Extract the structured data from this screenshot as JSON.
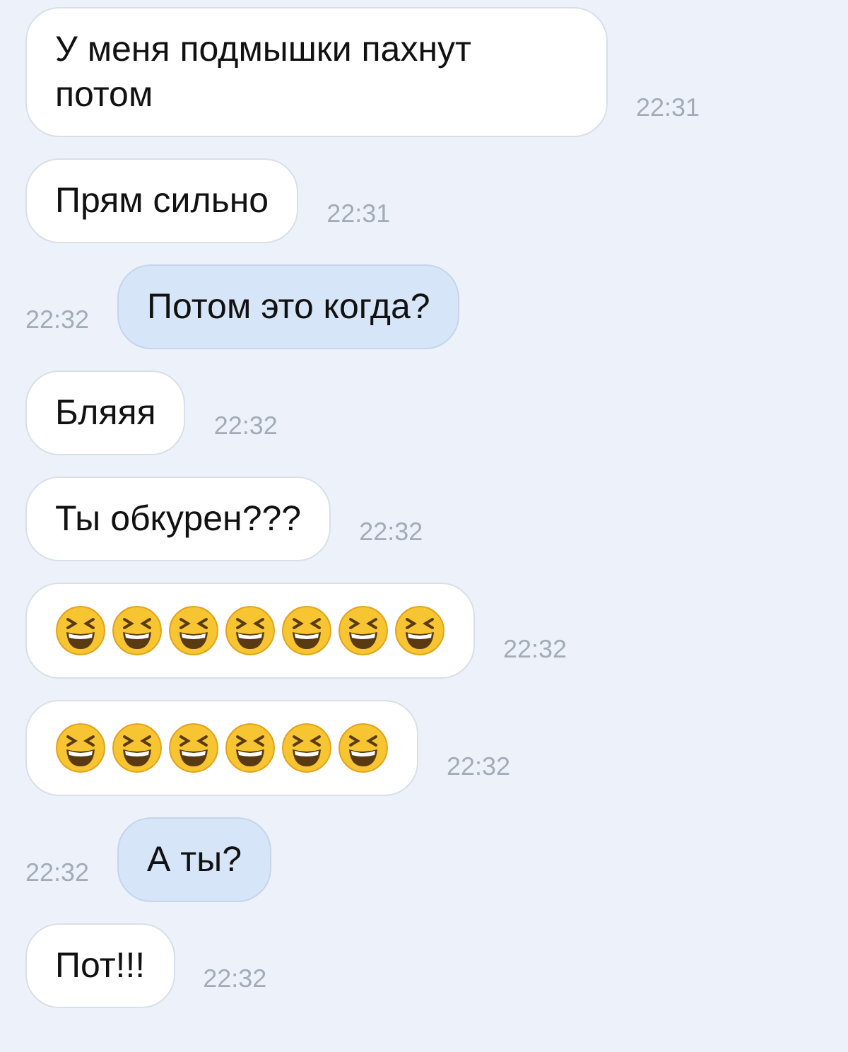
{
  "messages": [
    {
      "kind": "incoming",
      "text": "У меня подмышки пахнут потом",
      "time": "22:31"
    },
    {
      "kind": "incoming",
      "text": "Прям сильно",
      "time": "22:31"
    },
    {
      "kind": "outgoing",
      "text": "Потом это когда?",
      "time": "22:32"
    },
    {
      "kind": "incoming",
      "text": "Бляяя",
      "time": "22:32"
    },
    {
      "kind": "incoming",
      "text": "Ты обкурен???",
      "time": "22:32"
    },
    {
      "kind": "incoming",
      "emojis": [
        {
          "kind": "laughing"
        },
        {
          "kind": "laughing"
        },
        {
          "kind": "laughing"
        },
        {
          "kind": "laughing"
        },
        {
          "kind": "laughing"
        },
        {
          "kind": "laughing"
        },
        {
          "kind": "laughing"
        }
      ],
      "time": "22:32"
    },
    {
      "kind": "incoming",
      "emojis": [
        {
          "kind": "laughing"
        },
        {
          "kind": "laughing"
        },
        {
          "kind": "laughing"
        },
        {
          "kind": "laughing"
        },
        {
          "kind": "laughing"
        },
        {
          "kind": "laughing"
        }
      ],
      "time": "22:32"
    },
    {
      "kind": "outgoing",
      "text": "А ты?",
      "time": "22:32"
    },
    {
      "kind": "incoming",
      "text": "Пот!!!",
      "time": "22:32"
    }
  ]
}
